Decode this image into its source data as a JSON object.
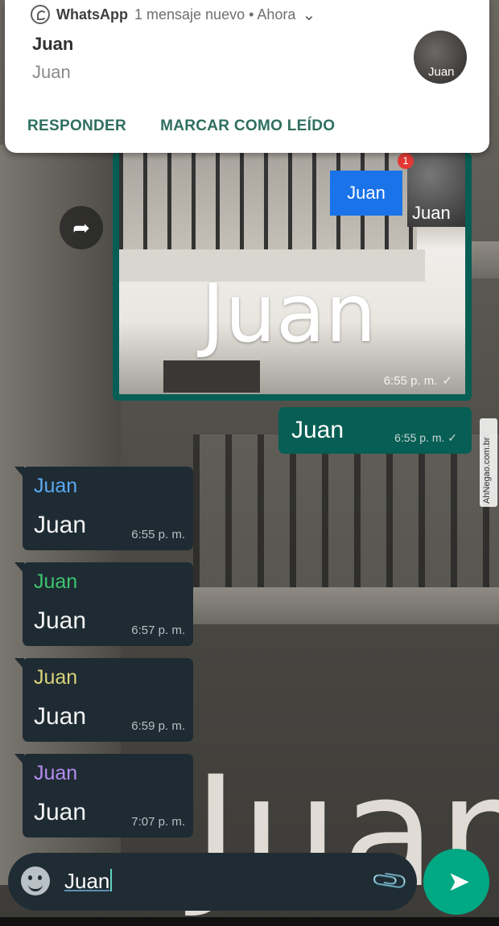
{
  "notification": {
    "app_name": "WhatsApp",
    "summary": "1 mensaje nuevo • Ahora",
    "title": "Juan",
    "body": "Juan",
    "avatar_label": "Juan",
    "actions": [
      "RESPONDER",
      "MARCAR COMO LEÍDO"
    ]
  },
  "media_message": {
    "tag_label": "Juan",
    "overlay_word": "Juan",
    "badge_count": "1",
    "badge_name": "Juan",
    "time": "6:55 p. m.",
    "status": "✓"
  },
  "outgoing": {
    "text": "Juan",
    "time": "6:55 p. m.",
    "status": "✓"
  },
  "incoming": [
    {
      "sender": "Juan",
      "sender_color": "#5aa9f0",
      "text": "Juan",
      "time": "6:55 p. m."
    },
    {
      "sender": "Juan",
      "sender_color": "#3ec46d",
      "text": "Juan",
      "time": "6:57 p. m."
    },
    {
      "sender": "Juan",
      "sender_color": "#d9d27a",
      "text": "Juan",
      "time": "6:59 p. m."
    },
    {
      "sender": "Juan",
      "sender_color": "#b58cf0",
      "text": "Juan",
      "time": "7:07 p. m."
    }
  ],
  "background_word": "Juan",
  "composer": {
    "value": "Juan"
  },
  "watermark": "AhNegao.com.br",
  "colors": {
    "accent": "#00a884",
    "outgoing_bubble": "#075e54",
    "incoming_bubble": "#1e2b33"
  }
}
